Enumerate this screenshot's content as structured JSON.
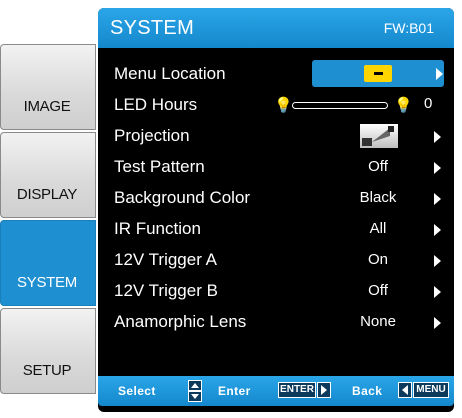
{
  "tabs": [
    {
      "label": "IMAGE",
      "active": false
    },
    {
      "label": "DISPLAY",
      "active": false
    },
    {
      "label": "SYSTEM",
      "active": true
    },
    {
      "label": "SETUP",
      "active": false
    }
  ],
  "header": {
    "title": "SYSTEM",
    "firmware": "FW:B01"
  },
  "menu": {
    "menu_location": {
      "label": "Menu Location"
    },
    "led_hours": {
      "label": "LED Hours",
      "value": "0",
      "level": 0
    },
    "projection": {
      "label": "Projection"
    },
    "test_pattern": {
      "label": "Test Pattern",
      "value": "Off"
    },
    "background_color": {
      "label": "Background Color",
      "value": "Black"
    },
    "ir_function": {
      "label": "IR Function",
      "value": "All"
    },
    "trigger_a": {
      "label": "12V Trigger A",
      "value": "On"
    },
    "trigger_b": {
      "label": "12V Trigger B",
      "value": "Off"
    },
    "anamorphic": {
      "label": "Anamorphic Lens",
      "value": "None"
    }
  },
  "help": {
    "select": "Select",
    "enter": "Enter",
    "enter_key": "ENTER",
    "back": "Back",
    "menu_key": "MENU"
  },
  "colors": {
    "accent": "#1e8fd0",
    "highlight": "#ffd500",
    "panel": "#000000"
  }
}
